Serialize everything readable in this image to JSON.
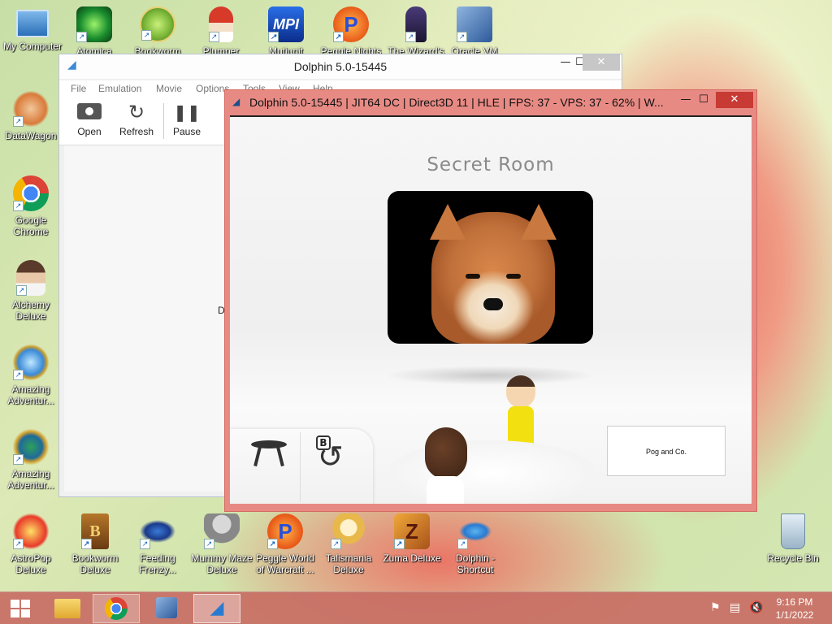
{
  "desktop_icons": [
    {
      "label": "My Computer",
      "icon": "computer-icon"
    },
    {
      "label": "Atomica",
      "icon": "atomic-icon"
    },
    {
      "label": "Bookworm",
      "icon": "bookworm-icon"
    },
    {
      "label": "Plumper",
      "icon": "gnome-icon"
    },
    {
      "label": "Mutiunit",
      "icon": "mpi-icon"
    },
    {
      "label": "Peggle Nights",
      "icon": "peggle-icon"
    },
    {
      "label": "The Wizard's",
      "icon": "wizard-icon"
    },
    {
      "label": "Oracle VM",
      "icon": "virtualbox-icon"
    },
    {
      "label": "DataWagon",
      "icon": "datawagon-icon"
    },
    {
      "label": "Google Chrome",
      "icon": "chrome-icon"
    },
    {
      "label": "Alchemy Deluxe",
      "icon": "alchemy-icon"
    },
    {
      "label": "Amazing Adventur...",
      "icon": "amazing-icon"
    },
    {
      "label": "Amazing Adventur...",
      "icon": "amazing-globe-icon"
    },
    {
      "label": "AstroPop Deluxe",
      "icon": "astropop-icon"
    },
    {
      "label": "Bookworm Deluxe",
      "icon": "bookworm-deluxe-icon"
    },
    {
      "label": "Feeding Frenzy...",
      "icon": "fish-icon"
    },
    {
      "label": "Mummy Maze Deluxe",
      "icon": "mummy-icon"
    },
    {
      "label": "Peggle World of Warcraft ...",
      "icon": "peggle-wow-icon"
    },
    {
      "label": "Talismania Deluxe",
      "icon": "talismania-icon"
    },
    {
      "label": "Zuma Deluxe",
      "icon": "zuma-icon"
    },
    {
      "label": "Dolphin - Shortcut",
      "icon": "dolphin-icon"
    },
    {
      "label": "Recycle Bin",
      "icon": "recycle-bin-icon"
    }
  ],
  "main_window": {
    "title": "Dolphin 5.0-15445",
    "menu": [
      "File",
      "Emulation",
      "Movie",
      "Options",
      "Tools",
      "View",
      "Help"
    ],
    "toolbar": {
      "open": "Open",
      "refresh": "Refresh",
      "pause": "Pause"
    },
    "side_char": "D"
  },
  "render_window": {
    "title": "Dolphin 5.0-15445 | JIT64 DC | Direct3D 11 | HLE | FPS: 37 - VPS: 37 - 62% | W...",
    "room_title": "Secret Room",
    "sign_text": "Pog and Co.",
    "b_button": "B"
  },
  "taskbar": {
    "time": "9:16 PM",
    "date": "1/1/2022",
    "items": [
      "windows-start-icon",
      "file-explorer-icon",
      "chrome-icon",
      "virtualbox-icon",
      "dolphin-icon"
    ],
    "tray": [
      "action-center-flag-icon",
      "network-icon",
      "volume-muted-icon"
    ]
  },
  "colors": {
    "render_border": "#e88a84",
    "taskbar": "#c86e64",
    "accent": "#1565c0"
  }
}
